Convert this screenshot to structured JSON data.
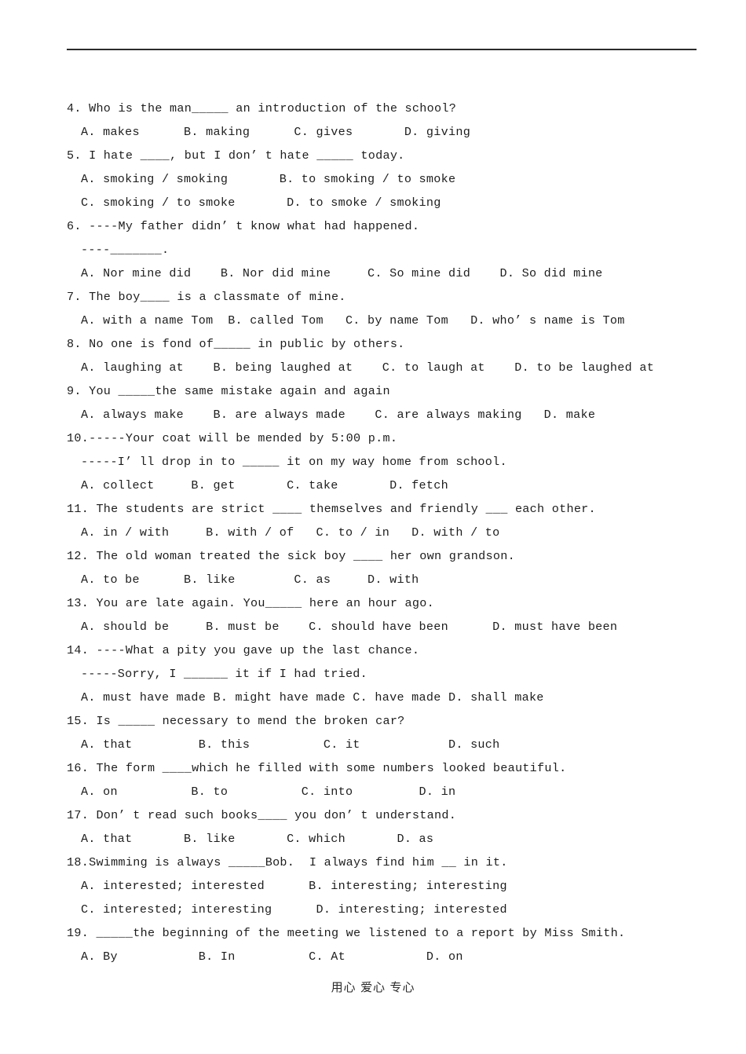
{
  "document": {
    "footer_note": "用心 爱心 专心",
    "rule_color": "#2b2b2b",
    "text_color": "#1d1d1d"
  },
  "lines": [
    {
      "id": "q4-stem",
      "kind": "q",
      "text": "4. Who is the man_____ an introduction of the school?"
    },
    {
      "id": "q4-opts",
      "kind": "opt",
      "text": "A. makes      B. making      C. gives       D. giving"
    },
    {
      "id": "q5-stem",
      "kind": "q",
      "text": "5. I hate ____, but I don’ t hate _____ today."
    },
    {
      "id": "q5-optsAB",
      "kind": "opt",
      "text": "A. smoking / smoking       B. to smoking / to smoke"
    },
    {
      "id": "q5-optsCD",
      "kind": "opt",
      "text": "C. smoking / to smoke       D. to smoke / smoking"
    },
    {
      "id": "q6-stem",
      "kind": "q",
      "text": "6. ----My father didn’ t know what had happened."
    },
    {
      "id": "q6-stem2",
      "kind": "cont",
      "text": "----_______."
    },
    {
      "id": "q6-opts",
      "kind": "opt",
      "text": "A. Nor mine did    B. Nor did mine     C. So mine did    D. So did mine"
    },
    {
      "id": "q7-stem",
      "kind": "q",
      "text": "7. The boy____ is a classmate of mine."
    },
    {
      "id": "q7-opts",
      "kind": "opt",
      "text": "A. with a name Tom  B. called Tom   C. by name Tom   D. who’ s name is Tom"
    },
    {
      "id": "q8-stem",
      "kind": "q",
      "text": "8. No one is fond of_____ in public by others."
    },
    {
      "id": "q8-opts",
      "kind": "opt",
      "text": "A. laughing at    B. being laughed at    C. to laugh at    D. to be laughed at"
    },
    {
      "id": "q9-stem",
      "kind": "q",
      "text": "9. You _____the same mistake again and again"
    },
    {
      "id": "q9-opts",
      "kind": "opt",
      "text": "A. always make    B. are always made    C. are always making   D. make"
    },
    {
      "id": "q10-stem",
      "kind": "q",
      "text": "10.-----Your coat will be mended by 5:00 p.m."
    },
    {
      "id": "q10-stem2",
      "kind": "cont",
      "text": "-----I’ ll drop in to _____ it on my way home from school."
    },
    {
      "id": "q10-opts",
      "kind": "opt",
      "text": "A. collect     B. get       C. take       D. fetch"
    },
    {
      "id": "q11-stem",
      "kind": "q",
      "text": "11. The students are strict ____ themselves and friendly ___ each other."
    },
    {
      "id": "q11-opts",
      "kind": "opt",
      "text": "A. in / with     B. with / of   C. to / in   D. with / to"
    },
    {
      "id": "q12-stem",
      "kind": "q",
      "text": "12. The old woman treated the sick boy ____ her own grandson."
    },
    {
      "id": "q12-opts",
      "kind": "opt",
      "text": "A. to be      B. like        C. as     D. with"
    },
    {
      "id": "q13-stem",
      "kind": "q",
      "text": "13. You are late again. You_____ here an hour ago."
    },
    {
      "id": "q13-opts",
      "kind": "opt",
      "text": "A. should be     B. must be    C. should have been      D. must have been"
    },
    {
      "id": "q14-stem",
      "kind": "q",
      "text": "14. ----What a pity you gave up the last chance."
    },
    {
      "id": "q14-stem2",
      "kind": "cont",
      "text": "-----Sorry, I ______ it if I had tried."
    },
    {
      "id": "q14-opts",
      "kind": "opt",
      "text": "A. must have made B. might have made C. have made D. shall make"
    },
    {
      "id": "q15-stem",
      "kind": "q",
      "text": "15. Is _____ necessary to mend the broken car?"
    },
    {
      "id": "q15-opts",
      "kind": "opt",
      "text": "A. that         B. this          C. it            D. such"
    },
    {
      "id": "q16-stem",
      "kind": "q",
      "text": "16. The form ____which he filled with some numbers looked beautiful."
    },
    {
      "id": "q16-opts",
      "kind": "opt",
      "text": "A. on          B. to          C. into         D. in"
    },
    {
      "id": "q17-stem",
      "kind": "q",
      "text": "17. Don’ t read such books____ you don’ t understand."
    },
    {
      "id": "q17-opts",
      "kind": "opt",
      "text": "A. that       B. like       C. which       D. as"
    },
    {
      "id": "q18-stem",
      "kind": "q",
      "text": "18.Swimming is always _____Bob.  I always find him __ in it."
    },
    {
      "id": "q18-optsAB",
      "kind": "opt",
      "text": "A. interested; interested      B. interesting; interesting"
    },
    {
      "id": "q18-optsCD",
      "kind": "opt",
      "text": "C. interested; interesting      D. interesting; interested"
    },
    {
      "id": "q19-stem",
      "kind": "q",
      "text": "19. _____the beginning of the meeting we listened to a report by Miss Smith."
    },
    {
      "id": "q19-opts",
      "kind": "opt",
      "text": "A. By           B. In          C. At           D. on"
    }
  ]
}
